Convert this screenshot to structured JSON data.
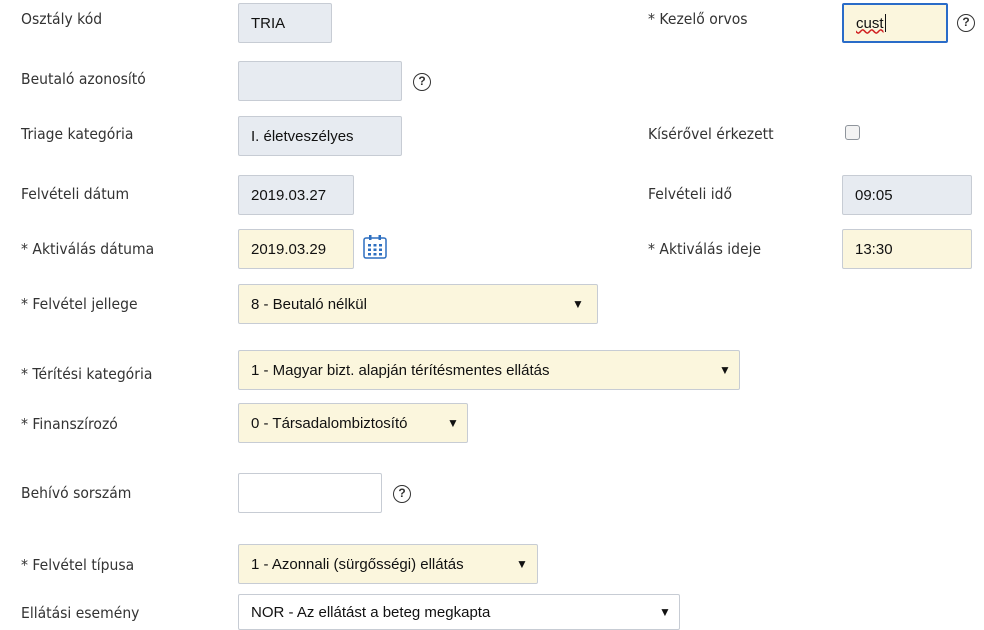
{
  "osztaly_kod": {
    "label": "Osztály kód",
    "value": "TRIA"
  },
  "kezelo_orvos": {
    "label": "* Kezelő orvos",
    "value": "cust"
  },
  "beutalo_azonosito": {
    "label": "Beutaló azonosító",
    "value": ""
  },
  "triage_kategoria": {
    "label": "Triage kategória",
    "value": "I. életveszélyes"
  },
  "kiserovel_erkezett": {
    "label": "Kísérővel érkezett",
    "checked": false
  },
  "felveteli_datum": {
    "label": "Felvételi dátum",
    "value": "2019.03.27"
  },
  "felveteli_ido": {
    "label": "Felvételi idő",
    "value": "09:05"
  },
  "aktivalas_datuma": {
    "label": "* Aktiválás dátuma",
    "value": "2019.03.29"
  },
  "aktivalas_ideje": {
    "label": "* Aktiválás ideje",
    "value": "13:30"
  },
  "felvetel_jellege": {
    "label": "* Felvétel jellege",
    "selected": "8 - Beutaló nélkül"
  },
  "teritesi_kategoria": {
    "label": "* Térítési kategória",
    "selected": "1 - Magyar bizt. alapján térítésmentes ellátás"
  },
  "finanszirozo": {
    "label": "* Finanszírozó",
    "selected": "0 - Társadalombiztosító"
  },
  "behivo_sorszam": {
    "label": "Behívó sorszám",
    "value": ""
  },
  "felvetel_tipusa": {
    "label": "* Felvétel típusa",
    "selected": "1 - Azonnali (sürgősségi) ellátás"
  },
  "ellatasi_esemeny": {
    "label": "Ellátási esemény",
    "selected": "NOR - Az ellátást a beteg megkapta"
  },
  "icons": {
    "help": "help-circle-icon",
    "calendar": "calendar-icon",
    "dropdown": "dropdown-arrow-icon"
  },
  "help_glyph": "?",
  "arrow_glyph": "▼",
  "colors": {
    "readonly_bg": "#e7ebf1",
    "required_bg": "#fbf6dd",
    "focus_border": "#2a6cc8"
  }
}
